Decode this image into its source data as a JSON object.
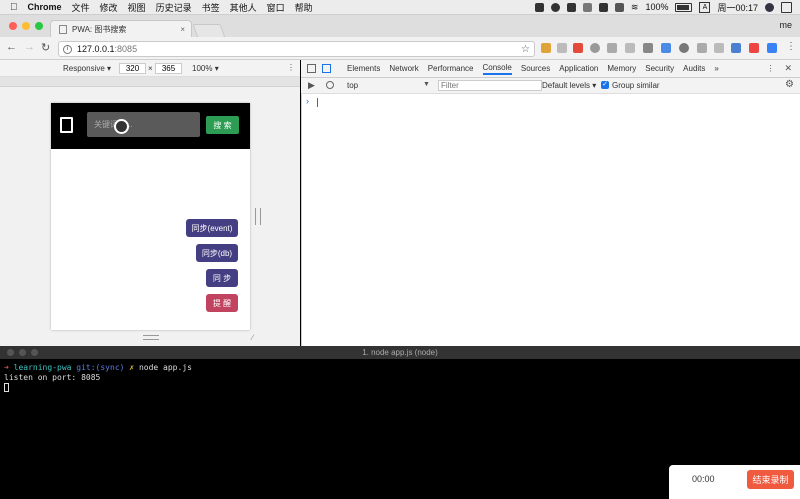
{
  "menubar": {
    "app": "Chrome",
    "menus": [
      "文件",
      "修改",
      "视图",
      "历史记录",
      "书签",
      "其他人",
      "窗口",
      "帮助"
    ],
    "battery": "100%",
    "clock": "周一00:17",
    "user": "me"
  },
  "tab": {
    "title": "PWA: 图书搜索",
    "close": "×"
  },
  "address": {
    "host": "127.0.0.1",
    "port": ":8085"
  },
  "device": {
    "mode": "Responsive",
    "width": "320",
    "x": "×",
    "height": "365",
    "zoom": "100%"
  },
  "app": {
    "search_placeholder": "关键词搜...",
    "search_button": "搜 索",
    "buttons": [
      {
        "label": "同步(event)",
        "color": "#443f82"
      },
      {
        "label": "同步(db)",
        "color": "#443f82"
      },
      {
        "label": "同 步",
        "color": "#443f82"
      },
      {
        "label": "提 醒",
        "color": "#c0445f"
      }
    ]
  },
  "devtools": {
    "tabs": [
      "Elements",
      "Network",
      "Performance",
      "Console",
      "Sources",
      "Application",
      "Memory",
      "Security",
      "Audits"
    ],
    "active_tab": "Console",
    "more": "»",
    "context": "top",
    "filter_placeholder": "Filter",
    "levels": "Default levels",
    "group_similar": "Group similar",
    "prompt": "›"
  },
  "terminal": {
    "title": "1. node app.js (node)",
    "arrow": "➜",
    "dir": "learning-pwa",
    "git": "git:(sync)",
    "dirty": "✗",
    "cmd": "node app.js",
    "output": "listen on port: 8085"
  },
  "recorder": {
    "time": "00:00",
    "stop_label": "结束录制"
  }
}
